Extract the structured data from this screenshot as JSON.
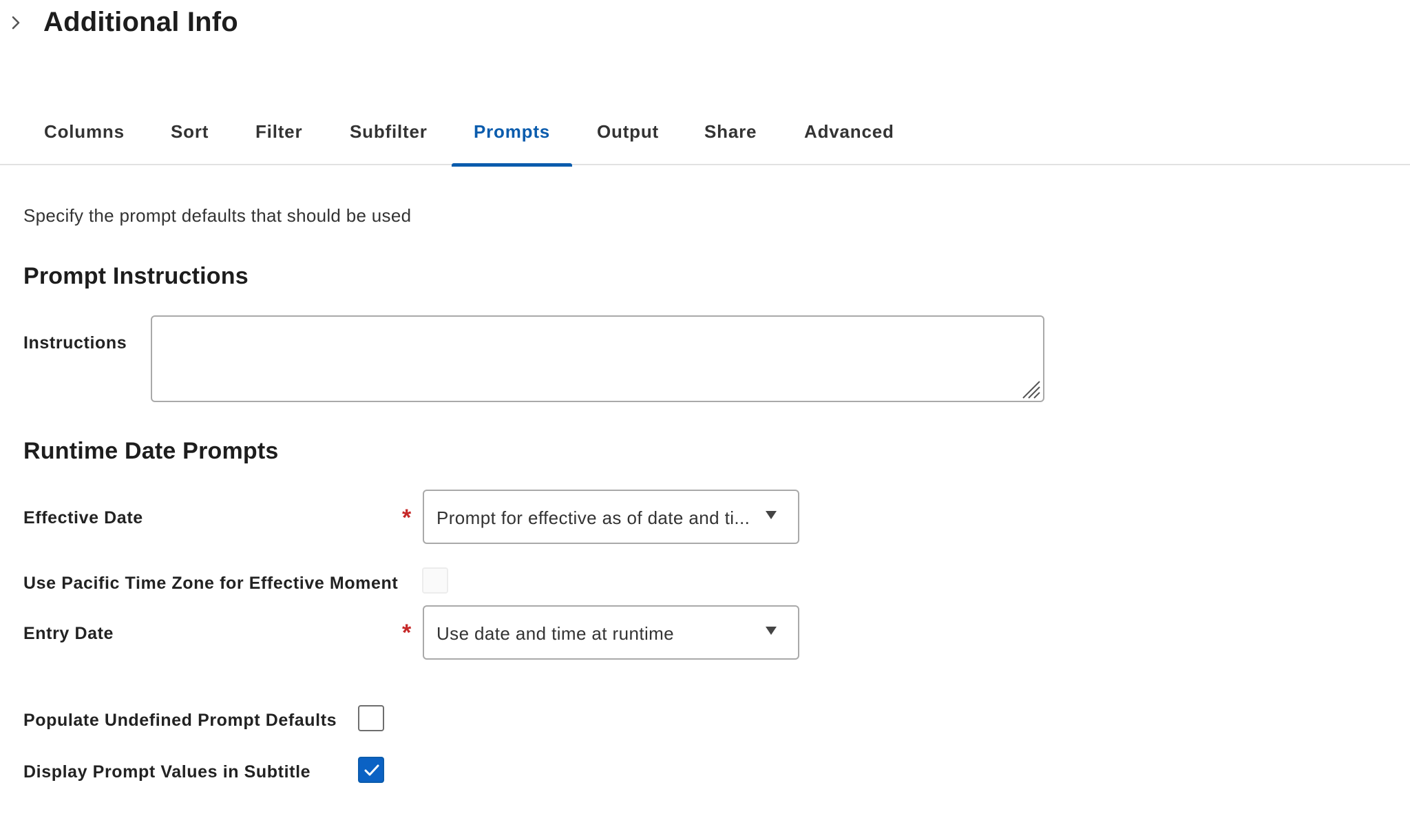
{
  "header": {
    "title": "Additional Info"
  },
  "tabs": [
    {
      "label": "Columns",
      "active": false
    },
    {
      "label": "Sort",
      "active": false
    },
    {
      "label": "Filter",
      "active": false
    },
    {
      "label": "Subfilter",
      "active": false
    },
    {
      "label": "Prompts",
      "active": true
    },
    {
      "label": "Output",
      "active": false
    },
    {
      "label": "Share",
      "active": false
    },
    {
      "label": "Advanced",
      "active": false
    }
  ],
  "content": {
    "description": "Specify the prompt defaults that should be used",
    "prompt_instructions": {
      "title": "Prompt Instructions",
      "instructions_label": "Instructions",
      "instructions_value": ""
    },
    "runtime_date_prompts": {
      "title": "Runtime Date Prompts",
      "effective_date": {
        "label": "Effective Date",
        "required_marker": "*",
        "value": "Prompt for effective as of date and ti..."
      },
      "pacific_time_zone": {
        "label": "Use Pacific Time Zone for Effective Moment",
        "checked": false,
        "disabled": true
      },
      "entry_date": {
        "label": "Entry Date",
        "required_marker": "*",
        "value": "Use date and time at runtime"
      }
    },
    "populate_undefined": {
      "label": "Populate Undefined Prompt Defaults",
      "checked": false
    },
    "display_prompt_values": {
      "label": "Display Prompt Values in Subtitle",
      "checked": true
    }
  },
  "colors": {
    "accent": "#0b5cad",
    "required": "#c62828",
    "checkbox_checked": "#0b62c4"
  }
}
